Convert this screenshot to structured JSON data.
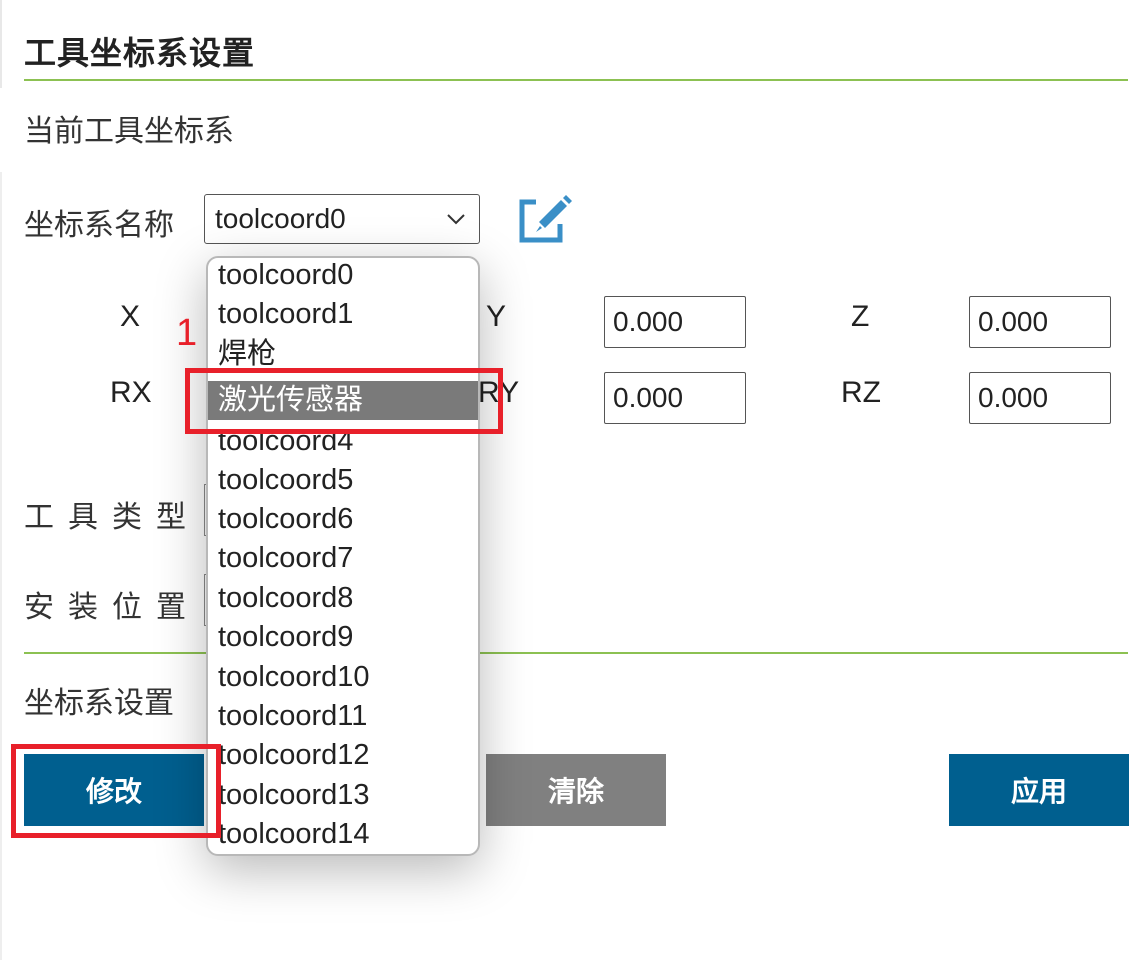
{
  "panel": {
    "title": "工具坐标系设置"
  },
  "current_section": {
    "label": "当前工具坐标系"
  },
  "coord_name": {
    "label": "坐标系名称",
    "selected": "toolcoord0"
  },
  "icons": {
    "edit": "edit-square-icon",
    "chevron": "chevron-down-icon"
  },
  "fields": {
    "x": {
      "label": "X",
      "value": "0.000"
    },
    "y": {
      "label": "Y",
      "value": "0.000"
    },
    "z": {
      "label": "Z",
      "value": "0.000"
    },
    "rx": {
      "label": "RX",
      "value": "0.000"
    },
    "ry": {
      "label": "RY",
      "value": "0.000"
    },
    "rz": {
      "label": "RZ",
      "value": "0.000"
    }
  },
  "tool_type": {
    "label": "工具类型"
  },
  "install_position": {
    "label": "安装位置"
  },
  "settings_section": {
    "label": "坐标系设置"
  },
  "buttons": {
    "modify": "修改",
    "clear": "清除",
    "apply": "应用"
  },
  "dropdown": {
    "options": [
      "toolcoord0",
      "toolcoord1",
      "焊枪",
      "激光传感器",
      "toolcoord4",
      "toolcoord5",
      "toolcoord6",
      "toolcoord7",
      "toolcoord8",
      "toolcoord9",
      "toolcoord10",
      "toolcoord11",
      "toolcoord12",
      "toolcoord13",
      "toolcoord14"
    ],
    "highlighted": "激光传感器"
  },
  "annotation": {
    "step_number": "1"
  },
  "colors": {
    "accent": "#005f8f",
    "divider": "#8cc152",
    "annotation": "#e8202a",
    "icon": "#3a8fc7",
    "selected_option": "#7a7a7a"
  }
}
